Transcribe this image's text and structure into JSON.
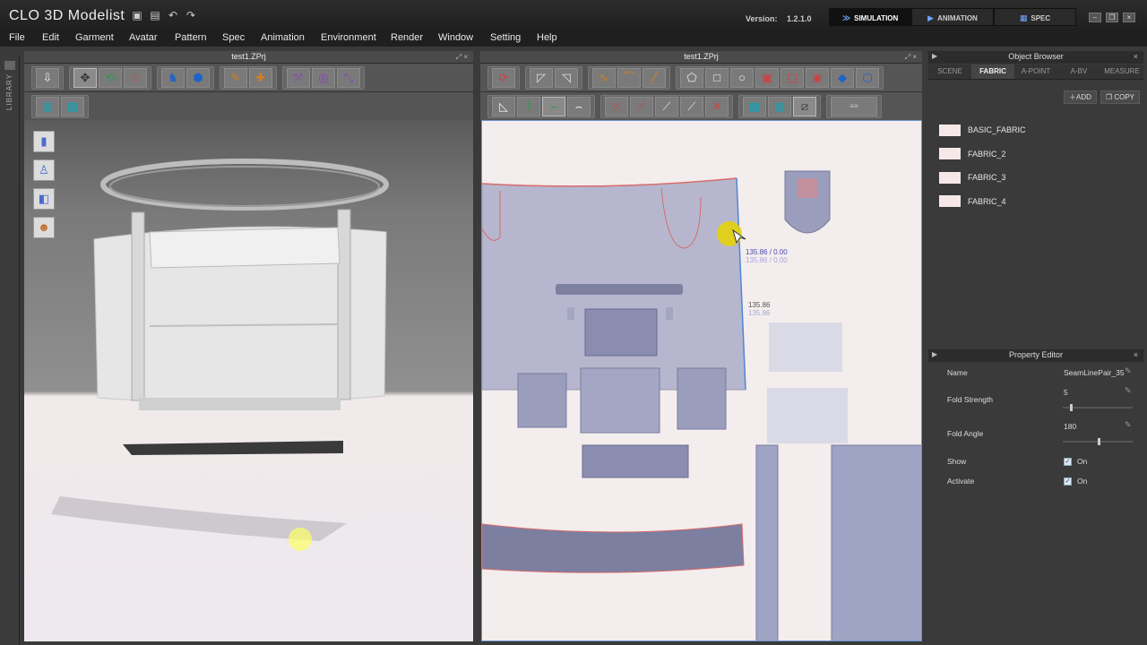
{
  "app": {
    "logo": "CLO 3D Modelist",
    "version_label": "Version:",
    "version_value": "1.2.1.0",
    "modes": [
      {
        "label": "SIMULATION",
        "icon": "simulation-icon",
        "active": true
      },
      {
        "label": "ANIMATION",
        "icon": "animation-icon",
        "active": false
      },
      {
        "label": "SPEC",
        "icon": "spec-icon",
        "active": false
      }
    ]
  },
  "menu": [
    "File",
    "Edit",
    "Garment",
    "Avatar",
    "Pattern",
    "Spec",
    "Animation",
    "Environment",
    "Render",
    "Window",
    "Setting",
    "Help"
  ],
  "library": {
    "label": "LIBRARY"
  },
  "view3d": {
    "title": "test1.ZPrj"
  },
  "view2d": {
    "title": "test1.ZPrj",
    "annotations": {
      "point_a": "135.86 / 0.00",
      "point_a_ghost": "135.86 / 0.00",
      "length": "135.86",
      "length_ghost": "135.86"
    }
  },
  "object_browser": {
    "title": "Object Browser",
    "tabs": [
      "SCENE",
      "FABRIC",
      "A-POINT",
      "A-BV",
      "MEASURE"
    ],
    "active_tab": "FABRIC",
    "add_label": "ADD",
    "copy_label": "COPY",
    "fabrics": [
      "BASIC_FABRIC",
      "FABRIC_2",
      "FABRIC_3",
      "FABRIC_4"
    ]
  },
  "property_editor": {
    "title": "Property Editor",
    "name_label": "Name",
    "name_value": "SeamLinePair_35",
    "fold_strength_label": "Fold Strength",
    "fold_strength_value": "5",
    "fold_strength_level": 0.1,
    "fold_angle_label": "Fold Angle",
    "fold_angle_value": "180",
    "fold_angle_level": 0.5,
    "show_label": "Show",
    "show_value": "On",
    "activate_label": "Activate",
    "activate_value": "On"
  },
  "colors": {
    "accent": "#1e63c8",
    "pattern_fill": "#8e95b8",
    "seam_red": "#d86b6b",
    "highlight_yellow": "#e8d400"
  }
}
